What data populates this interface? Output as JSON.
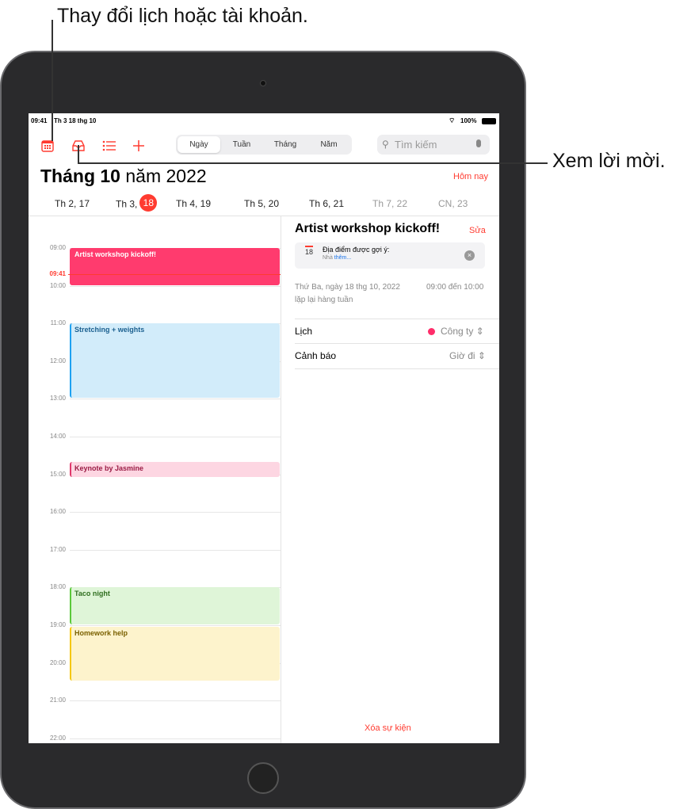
{
  "annotations": {
    "top": "Thay đổi lịch hoặc tài khoản.",
    "right": "Xem lời mời."
  },
  "status": {
    "time": "09:41",
    "date": "Th 3 18 thg 10",
    "battery": "100%"
  },
  "toolbar": {
    "icons": [
      "calendar-icon",
      "inbox-icon",
      "list-icon",
      "plus-icon"
    ],
    "segments": [
      "Ngày",
      "Tuần",
      "Tháng",
      "Năm"
    ],
    "selected": "Ngày",
    "search_placeholder": "Tìm kiếm"
  },
  "header": {
    "month": "Tháng 10",
    "year": "năm 2022",
    "today": "Hôm nay"
  },
  "week": [
    {
      "label": "Th 2, 17"
    },
    {
      "label": "Th 3,",
      "num": "18"
    },
    {
      "label": "Th 4, 19"
    },
    {
      "label": "Th 5, 20"
    },
    {
      "label": "Th 6, 21"
    },
    {
      "label": "Th 7, 22"
    },
    {
      "label": "CN, 23"
    }
  ],
  "hours": [
    "09:00",
    "10:00",
    "11:00",
    "12:00",
    "13:00",
    "14:00",
    "15:00",
    "16:00",
    "17:00",
    "18:00",
    "19:00",
    "20:00",
    "21:00",
    "22:00"
  ],
  "now": "09:41",
  "events": [
    {
      "title": "Artist workshop kickoff!",
      "start": 9,
      "end": 10,
      "bg": "#ff3b6e",
      "fg": "#ffffff",
      "bar": "#ff3b6e"
    },
    {
      "title": "Stretching + weights",
      "start": 11,
      "end": 13,
      "bg": "#d2ecfa",
      "fg": "#1a5f8f",
      "bar": "#1ea1f1"
    },
    {
      "title": "Keynote by Jasmine",
      "start": 14.67,
      "end": 15.1,
      "bg": "#fdd6e2",
      "fg": "#9b1c45",
      "bar": "#e0386c"
    },
    {
      "title": "Taco night",
      "start": 18,
      "end": 19,
      "bg": "#dff5d8",
      "fg": "#2f6e1f",
      "bar": "#5ac93a"
    },
    {
      "title": "Homework help",
      "start": 19.05,
      "end": 20.5,
      "bg": "#fdf3cc",
      "fg": "#7a6100",
      "bar": "#f5c70c"
    }
  ],
  "detail": {
    "title": "Artist workshop kickoff!",
    "edit": "Sửa",
    "suggest_title": "Địa điểm được gợi ý:",
    "suggest_prefix": "Nhà",
    "suggest_link": "thêm...",
    "cal_num": "18",
    "date": "Thứ Ba, ngày 18 thg 10, 2022",
    "time": "09:00 đến 10:00",
    "repeat": "lặp lại hàng tuần",
    "calendar_label": "Lịch",
    "calendar_value": "Công ty",
    "calendar_color": "#ff2d6a",
    "alert_label": "Cảnh báo",
    "alert_value": "Giờ đi",
    "delete": "Xóa sự kiện"
  }
}
